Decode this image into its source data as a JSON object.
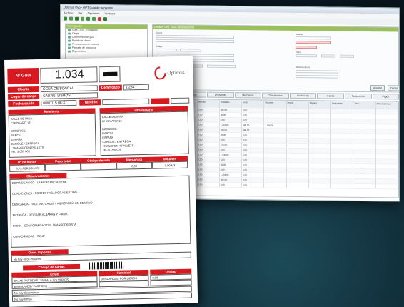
{
  "window": {
    "title": "Optimus Vivo - OPT Guia de transporte",
    "menu": [
      "Archivo",
      "Ver",
      "Opciones",
      "Ventana"
    ],
    "left_panel": {
      "header": "Navegación",
      "items": [
        "Guía 1.034 · Transporte",
        "Carga",
        "Documentación guía",
        "Pedido de cliente",
        "Presupuestos de compra",
        "Facturas de proveedor",
        "Expedientes"
      ]
    },
    "right_panel": {
      "header": "Detalle OPT Guía de transporte",
      "fields": {
        "a": "Cliente",
        "b": "Código",
        "c": "Fecha carga",
        "d": "Destino",
        "e": "Peso",
        "f": "Observaciones"
      }
    },
    "buttons": [
      "Aceptar",
      "Cerrar"
    ],
    "tabs": [
      "General",
      "Cargas",
      "Descargas",
      "Mercancía",
      "Documentos",
      "Incidencias",
      "Costes",
      "Facturación",
      "Pagos"
    ],
    "grid": {
      "headers": [
        "Línea",
        "Código",
        "Artículo",
        "Unidades",
        "Peso",
        "Volumen",
        "Precio",
        "Importe",
        "Descuento",
        "Total",
        "Observaciones"
      ],
      "rows": [
        [
          "1",
          "1.034",
          "0,00",
          "305,00",
          "0,00",
          "",
          "",
          "",
          "",
          "",
          ""
        ],
        [
          "2",
          "1.035",
          "0,00",
          "80,00",
          "0,00",
          "",
          "",
          "",
          "",
          "",
          ""
        ],
        [
          "3",
          "1.036",
          "0,00",
          "0,00",
          "0,00",
          "",
          "",
          "",
          "",
          "",
          ""
        ],
        [
          "4",
          "1.037",
          "0,00",
          "1.204,00",
          "480,00",
          "1.528,00",
          "",
          "",
          "",
          "",
          ""
        ],
        [
          "5",
          "1.038",
          "0,00",
          "780,00",
          "480,00",
          "",
          "",
          "",
          "",
          "",
          ""
        ],
        [
          "6",
          "1.039",
          "0,00",
          "30,00",
          "0,00",
          "",
          "",
          "",
          "",
          "",
          ""
        ],
        [
          "7",
          "1.040",
          "0,00",
          "0,00",
          "0,00",
          "",
          "",
          "",
          "",
          "",
          ""
        ],
        [
          "8",
          "1.041",
          "0,00",
          "150,00",
          "0,00",
          "",
          "",
          "",
          "",
          "",
          ""
        ],
        [
          "9",
          "1.042",
          "0,00",
          "0,00",
          "0,00",
          "",
          "",
          "",
          "",
          "",
          ""
        ],
        [
          "10",
          "1.043",
          "0,00",
          "1.930,00",
          "0,00",
          "",
          "",
          "",
          "",
          "",
          ""
        ],
        [
          "11",
          "1.044",
          "0,00",
          "0,00",
          "0,00",
          "",
          "",
          "",
          "",
          "",
          ""
        ],
        [
          "12",
          "1.045",
          "0,00",
          "80,00",
          "0,00",
          "",
          "",
          "",
          "",
          "",
          ""
        ],
        [
          "13",
          "1.046",
          "0,00",
          "0,00",
          "0,00",
          "",
          "",
          "",
          "",
          "",
          ""
        ],
        [
          "14",
          "1.047",
          "0,00",
          "1.204,00",
          "0,00",
          "",
          "",
          "",
          "",
          "",
          ""
        ],
        [
          "15",
          "1.048",
          "0,00",
          "305,00",
          "0,00",
          "",
          "",
          "",
          "",
          "",
          ""
        ],
        [
          "16",
          "1.049",
          "0,00",
          "0,00",
          "0,00",
          "",
          "",
          "",
          "",
          "",
          ""
        ]
      ]
    }
  },
  "sheet": {
    "number_label": "Nº Guía",
    "number": "1.034",
    "logo": "Optimus",
    "client_label": "Cliente",
    "client": "CCNA DE BOSCAL",
    "cert_label": "Certificado",
    "cert": "1.234",
    "load_label": "Lugar de carga",
    "load": "CARREI LIBROS",
    "date_label": "Fecha salida",
    "date": "08/07/15 08:37",
    "carrier_label": "Tracción",
    "remit_label": "Remitente",
    "dest_label": "Destinatario",
    "remit_lines": [
      "CALLE DE MINA",
      "C/ EDUARD 13",
      "",
      "BOSBRICE",
      "BARCEL",
      "ESPAÑA",
      "CARGUE / ENTREGA",
      ", TRANSPOR 4 PALLETS",
      "Tel.: 5 005 005"
    ],
    "dest_lines": [
      "CALLE DE MINA",
      "C/ EDUARD 13",
      "",
      "BOSBRICE",
      "BARCEL",
      "ESPAÑA",
      "CARGUE / ENTREGA",
      "TRANSPOR 4 PALLETS",
      "Tel.: 5 005 005"
    ],
    "info_headers": [
      "Nº de bultos",
      "Peso total",
      "Código de ruta",
      "Mercancía",
      "Volumen"
    ],
    "info_values": [
      "0,75 PERSONAS",
      "",
      "",
      "0,00",
      "0,00 M3"
    ],
    "obs_label": "Observaciones",
    "obs_lines": [
      "COPIA DE AVISO · LA MERCANCÍA DEBE",
      "CONDICIONES · PORTES PAGADOS A DESTINO",
      "DESCARGA · PALETAS, CAJAS Y MERCANCÍA EN DESTINO",
      "ENTREGA · REVISAR ALBARÁN Y FIRMA",
      "FIRMA · CONFORMIDAD DEL TRANSPORTISTA",
      "CONFORMIDAD · SI/NO"
    ],
    "extra_label": "Otros importes",
    "extra_value": "No hay otros importes",
    "code_label": "Código de barras",
    "table_headers": [
      "Envío",
      "Cantidad",
      "Unidad"
    ],
    "table_rows": [
      [
        "CAJAS PARTIDAS / EMBALAJES VARIOS",
        "DESCARGAS POR LIBROS",
        "0,00"
      ],
      [
        "EMBALAJES / PARTIDAS",
        "",
        ""
      ]
    ],
    "footer_lines": [
      "No hay documentos",
      "No hay firmas"
    ]
  }
}
